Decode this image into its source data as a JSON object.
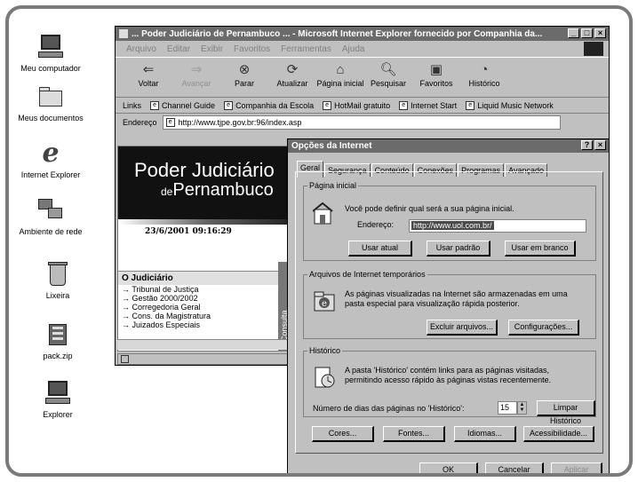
{
  "desktop": {
    "icons": [
      {
        "label": "Meu computador",
        "icon": "computer-icon"
      },
      {
        "label": "Meus documentos",
        "icon": "folder-icon"
      },
      {
        "label": "Internet Explorer",
        "icon": "ie-icon"
      },
      {
        "label": "Ambiente de rede",
        "icon": "network-icon"
      },
      {
        "label": "Lixeira",
        "icon": "recycle-bin-icon"
      },
      {
        "label": "pack.zip",
        "icon": "zip-icon"
      },
      {
        "label": "Explorer",
        "icon": "explorer-icon"
      }
    ]
  },
  "ie": {
    "title": "... Poder Judiciário de Pernambuco ... - Microsoft Internet Explorer fornecido por Companhia da...",
    "menu": [
      "Arquivo",
      "Editar",
      "Exibir",
      "Favoritos",
      "Ferramentas",
      "Ajuda"
    ],
    "toolbar": [
      "Voltar",
      "Avançar",
      "Parar",
      "Atualizar",
      "Página inicial",
      "Pesquisar",
      "Favoritos",
      "Histórico"
    ],
    "links_label": "Links",
    "links": [
      "Channel Guide",
      "Companhia da Escola",
      "HotMail gratuito",
      "Internet Start",
      "Liquid Music Network"
    ],
    "address_label": "Endereço",
    "address": "http://www.tjpe.gov.br:96/index.asp",
    "page": {
      "banner_line1": "Poder Judiciário",
      "banner_de": "de",
      "banner_line2": "Pernambuco",
      "datetime": "23/6/2001 09:16:29",
      "section_title": "O Judiciário",
      "list": [
        "Tribunal de Justiça",
        "Gestão 2000/2002",
        "Corregedoria Geral",
        "Cons. da Magistratura",
        "Juizados Especiais"
      ],
      "consulta": "Consulta"
    }
  },
  "dialog": {
    "title": "Opções da Internet",
    "tabs": [
      "Geral",
      "Segurança",
      "Conteúdo",
      "Conexões",
      "Programas",
      "Avançado"
    ],
    "home": {
      "legend": "Página inicial",
      "text": "Você pode definir qual será a sua página inicial.",
      "address_label": "Endereço:",
      "address_value": "http://www.uol.com.br/",
      "btn_current": "Usar atual",
      "btn_default": "Usar padrão",
      "btn_blank": "Usar em branco"
    },
    "temp": {
      "legend": "Arquivos de Internet temporários",
      "text": "As páginas visualizadas na Internet são armazenadas em uma pasta especial para visualização rápida posterior.",
      "btn_delete": "Excluir arquivos...",
      "btn_settings": "Configurações..."
    },
    "history": {
      "legend": "Histórico",
      "text": "A pasta 'Histórico' contém links para as páginas visitadas, permitindo acesso rápido às páginas vistas recentemente.",
      "days_label": "Número de dias das páginas no 'Histórico':",
      "days_value": "15",
      "btn_clear": "Limpar Histórico"
    },
    "bottom": [
      "Cores...",
      "Fontes...",
      "Idiomas...",
      "Acessibilidade..."
    ],
    "ok": "OK",
    "cancel": "Cancelar",
    "apply": "Aplicar"
  }
}
